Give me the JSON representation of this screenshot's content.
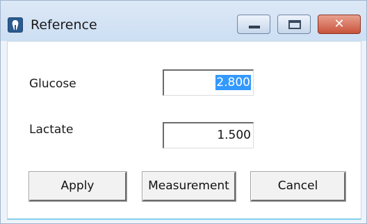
{
  "window": {
    "title": "Reference",
    "close_glyph": "✕"
  },
  "form": {
    "glucose_label": "Glucose",
    "glucose_value": "2.800",
    "lactate_label": "Lactate",
    "lactate_value": "1.500"
  },
  "buttons": {
    "apply": "Apply",
    "measurement": "Measurement",
    "cancel": "Cancel"
  },
  "icons": {
    "app": "app-icon",
    "minimize": "minimize-icon",
    "maximize": "maximize-icon",
    "close": "close-icon"
  },
  "colors": {
    "selection": "#3399ff",
    "close_button": "#c8523b",
    "titlebar": "#dce8f6"
  }
}
